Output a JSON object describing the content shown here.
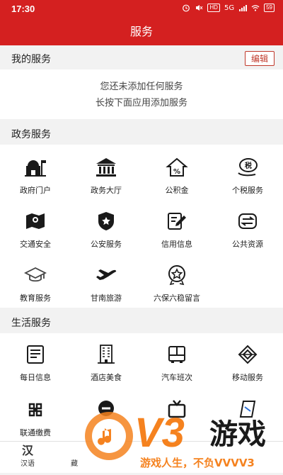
{
  "status": {
    "time": "17:30",
    "signal_text": "5G",
    "hd": "HD",
    "battery": "59"
  },
  "header": {
    "title": "服务"
  },
  "my_services": {
    "title": "我的服务",
    "edit_label": "编辑",
    "empty_line1": "您还未添加任何服务",
    "empty_line2": "长按下面应用添加服务"
  },
  "gov": {
    "title": "政务服务",
    "items": [
      {
        "label": "政府门户",
        "icon": "gov-portal-icon"
      },
      {
        "label": "政务大厅",
        "icon": "hall-icon"
      },
      {
        "label": "公积金",
        "icon": "fund-icon"
      },
      {
        "label": "个税服务",
        "icon": "tax-icon"
      },
      {
        "label": "交通安全",
        "icon": "traffic-map-icon"
      },
      {
        "label": "公安服务",
        "icon": "police-badge-icon"
      },
      {
        "label": "信用信息",
        "icon": "credit-edit-icon"
      },
      {
        "label": "公共资源",
        "icon": "exchange-icon"
      },
      {
        "label": "教育服务",
        "icon": "graduation-cap-icon"
      },
      {
        "label": "甘南旅游",
        "icon": "airplane-icon"
      },
      {
        "label": "六保六稳留言",
        "icon": "star-badge-icon"
      }
    ]
  },
  "life": {
    "title": "生活服务",
    "items": [
      {
        "label": "每日信息",
        "icon": "news-icon"
      },
      {
        "label": "酒店美食",
        "icon": "hotel-icon"
      },
      {
        "label": "汽车班次",
        "icon": "bus-icon"
      },
      {
        "label": "移动服务",
        "icon": "china-mobile-icon"
      },
      {
        "label": "联通缴费",
        "icon": "china-unicom-icon"
      }
    ]
  },
  "nav": {
    "items": [
      {
        "label": "汉语",
        "glyph": "汉"
      },
      {
        "label": "藏",
        "glyph": ""
      }
    ]
  },
  "watermark": {
    "logo": "V3",
    "name": "游戏",
    "slogan": "游戏人生，不负VVVV3"
  },
  "colors": {
    "brand": "#d42020",
    "accent": "#c0392b",
    "watermark_orange": "#f5821f"
  }
}
